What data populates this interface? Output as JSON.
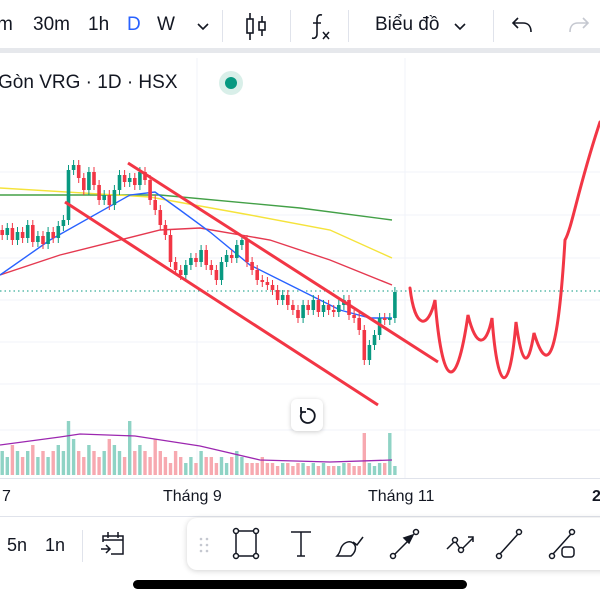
{
  "toolbar": {
    "intervals": [
      "m",
      "30m",
      "1h",
      "D",
      "W"
    ],
    "active_interval": "D",
    "chart_type_label": "Biểu đồ",
    "icons": [
      "chevron-down-icon",
      "candlestick-icon",
      "indicators-fx-icon",
      "undo-icon",
      "redo-icon"
    ]
  },
  "legend": {
    "title": "Gòn VRG · 1D · HSX",
    "status_color": "#089981"
  },
  "axis": {
    "labels": [
      "7",
      "Tháng 9",
      "Tháng 11",
      "2"
    ]
  },
  "bottom": {
    "ranges": [
      "5n",
      "1n"
    ],
    "icons": [
      "go-to-date-icon"
    ]
  },
  "drawing_tools": [
    "drag-handle-icon",
    "rectangle-icon",
    "text-icon",
    "brush-icon",
    "arrow-icon",
    "path-icon",
    "trend-line-icon",
    "line-shape-icon"
  ],
  "colors": {
    "up": "#089981",
    "down": "#f23645",
    "accent": "#2962ff",
    "drawing": "#f23645"
  },
  "chart_data": {
    "type": "candlestick",
    "closes": [
      16.5,
      17.2,
      16,
      16.8,
      16.2,
      17.5,
      15.8,
      16.4,
      15.6,
      16.8,
      16.2,
      17.4,
      18,
      23,
      23.5,
      22.2,
      21,
      22.8,
      21.5,
      20,
      20.5,
      19.5,
      21,
      22.5,
      21.8,
      22.2,
      21.5,
      22.8,
      22,
      20,
      19,
      17.5,
      16.5,
      13.8,
      13,
      12.5,
      13.5,
      14.2,
      13.8,
      15,
      13.5,
      13,
      12,
      13.8,
      14.5,
      14.2,
      15.5,
      16,
      13.8,
      13,
      12,
      11.8,
      11.5,
      11,
      10,
      10.5,
      9.5,
      9,
      8.2,
      9.5,
      9,
      10,
      8.8,
      9.5,
      9,
      8.8,
      9.5,
      10,
      8.5,
      8.2,
      7,
      4,
      5.5,
      6.5,
      8.2,
      8,
      8.2,
      10.8
    ],
    "volumes": [
      4,
      3,
      5,
      4,
      3,
      4,
      5,
      3,
      4,
      3,
      4,
      5,
      4,
      9,
      6,
      4,
      3,
      5,
      4,
      3,
      4,
      6,
      5,
      4,
      3,
      9,
      4,
      5,
      4,
      3,
      6,
      4,
      3,
      2,
      4,
      3,
      2,
      3,
      2,
      4,
      3,
      3,
      2,
      3,
      2,
      3,
      4,
      3,
      2,
      2,
      2,
      3,
      2,
      2,
      1.5,
      2,
      2,
      1.5,
      2,
      2,
      1.5,
      2,
      1.5,
      2,
      1.5,
      1.5,
      1.5,
      2,
      2,
      1.5,
      1.5,
      7,
      2,
      1.5,
      2,
      2,
      7,
      1.5
    ],
    "ma": [
      {
        "color": "#43a047",
        "values": [
          [
            0,
            20.5
          ],
          [
            160,
            20.5
          ],
          [
            300,
            19.2
          ],
          [
            392,
            18
          ]
        ]
      },
      {
        "color": "#f5e33b",
        "values": [
          [
            0,
            21.2
          ],
          [
            150,
            20.3
          ],
          [
            250,
            18.5
          ],
          [
            330,
            17
          ],
          [
            392,
            14.2
          ]
        ]
      },
      {
        "color": "#e53950",
        "values": [
          [
            0,
            12.5
          ],
          [
            60,
            14.5
          ],
          [
            160,
            17
          ],
          [
            200,
            17.2
          ],
          [
            270,
            16
          ],
          [
            330,
            14
          ],
          [
            392,
            11.5
          ]
        ]
      },
      {
        "color": "#2962ff",
        "values": [
          [
            0,
            12.5
          ],
          [
            50,
            16
          ],
          [
            130,
            20.5
          ],
          [
            155,
            20.8
          ],
          [
            180,
            19
          ],
          [
            210,
            16.8
          ],
          [
            250,
            13.5
          ],
          [
            290,
            11.5
          ],
          [
            340,
            9
          ],
          [
            370,
            8.2
          ],
          [
            392,
            8.2
          ]
        ]
      }
    ]
  }
}
